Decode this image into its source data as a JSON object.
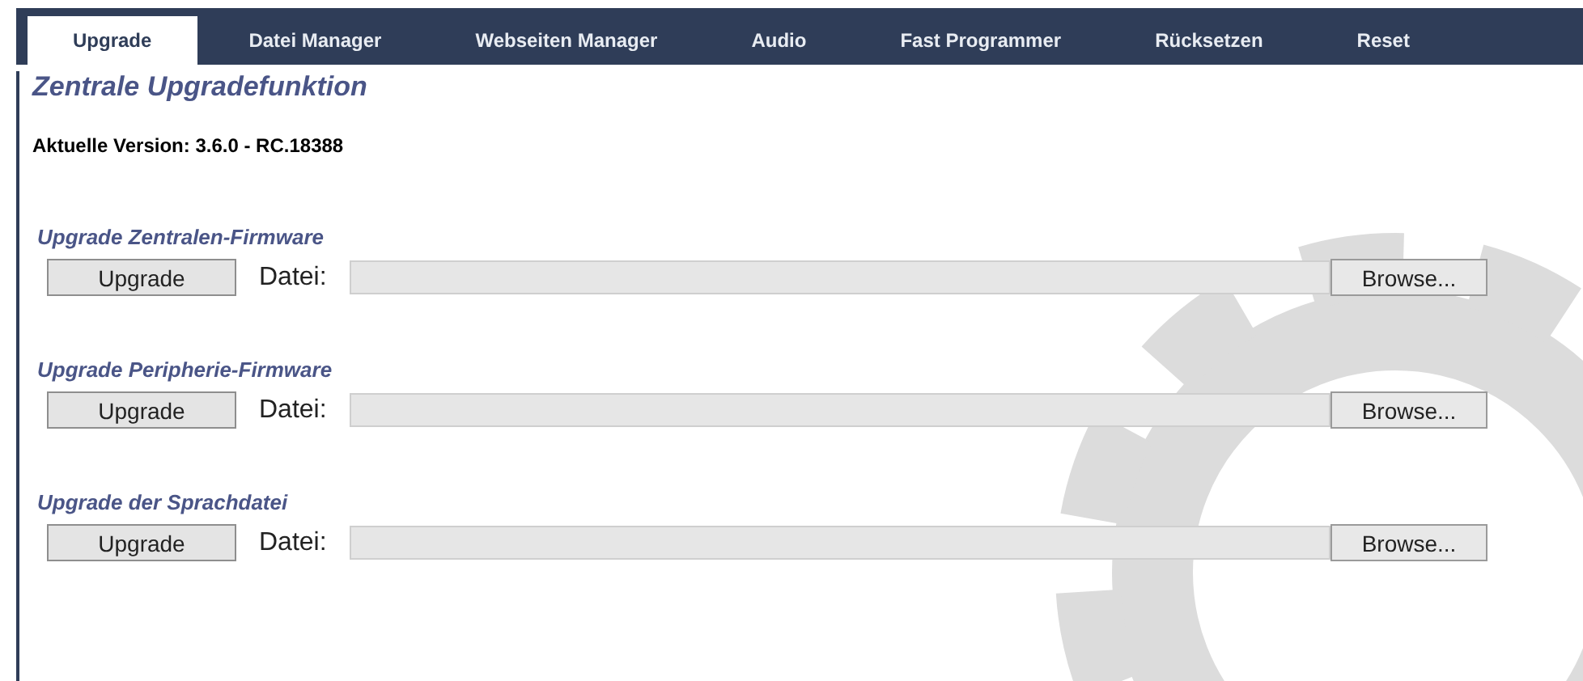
{
  "tabs": [
    {
      "label": "Upgrade",
      "selected": true
    },
    {
      "label": "Datei Manager",
      "selected": false
    },
    {
      "label": "Webseiten Manager",
      "selected": false
    },
    {
      "label": "Audio",
      "selected": false
    },
    {
      "label": "Fast Programmer",
      "selected": false
    },
    {
      "label": "Rücksetzen",
      "selected": false
    },
    {
      "label": "Reset",
      "selected": false
    }
  ],
  "page_title": "Zentrale Upgradefunktion",
  "current_version": "Aktuelle Version: 3.6.0 - RC.18388",
  "sections": [
    {
      "heading": "Upgrade Zentralen-Firmware",
      "button": "Upgrade",
      "file_label": "Datei:",
      "browse": "Browse..."
    },
    {
      "heading": "Upgrade Peripherie-Firmware",
      "button": "Upgrade",
      "file_label": "Datei:",
      "browse": "Browse..."
    },
    {
      "heading": "Upgrade der Sprachdatei",
      "button": "Upgrade",
      "file_label": "Datei:",
      "browse": "Browse..."
    }
  ]
}
